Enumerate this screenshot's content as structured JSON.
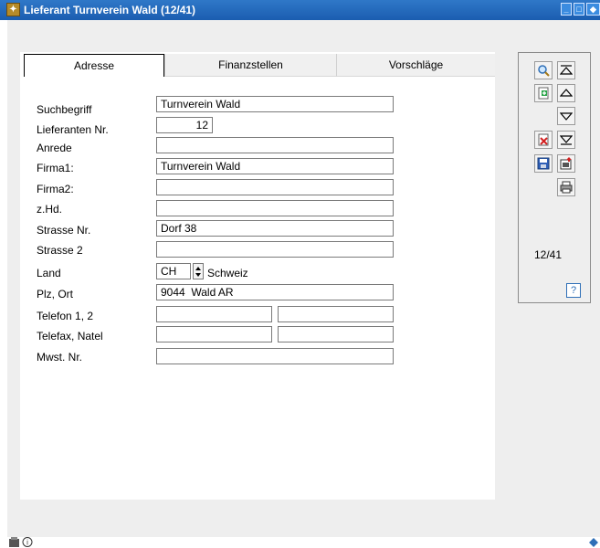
{
  "window": {
    "title": "Lieferant Turnverein Wald (12/41)",
    "titlebar_color": "#1b5db0"
  },
  "tabs": [
    {
      "label": "Adresse",
      "active": true
    },
    {
      "label": "Finanzstellen",
      "active": false
    },
    {
      "label": "Vorschläge",
      "active": false
    }
  ],
  "form": {
    "suchbegriff": {
      "label": "Suchbegriff",
      "value": "Turnverein Wald"
    },
    "lieferanten_nr": {
      "label": "Lieferanten Nr.",
      "value": "12"
    },
    "anrede": {
      "label": "Anrede",
      "value": ""
    },
    "firma1": {
      "label": "Firma1:",
      "value": "Turnverein Wald"
    },
    "firma2": {
      "label": "Firma2:",
      "value": ""
    },
    "zhd": {
      "label": "z.Hd.",
      "value": ""
    },
    "strasse_nr": {
      "label": "Strasse Nr.",
      "value": "Dorf 38"
    },
    "strasse2": {
      "label": "Strasse 2",
      "value": ""
    },
    "land": {
      "label": "Land",
      "code": "CH",
      "name": "Schweiz"
    },
    "plz_ort": {
      "label": "Plz, Ort",
      "value": "9044  Wald AR"
    },
    "telefon": {
      "label": "Telefon 1, 2",
      "value1": "",
      "value2": ""
    },
    "telefax": {
      "label": "Telefax, Natel",
      "value1": "",
      "value2": ""
    },
    "mwst": {
      "label": "Mwst. Nr.",
      "value": ""
    }
  },
  "sidebar": {
    "counter": "12/41",
    "help": "?",
    "icons": [
      "search-icon",
      "first-record-icon",
      "new-record-icon",
      "previous-record-icon",
      "next-record-icon",
      "delete-record-icon",
      "last-record-icon",
      "save-icon",
      "export-icon",
      "print-icon",
      "help-icon"
    ]
  },
  "colors": {
    "accent": "#2f6fb7",
    "window_bg": "#eeeeee"
  }
}
